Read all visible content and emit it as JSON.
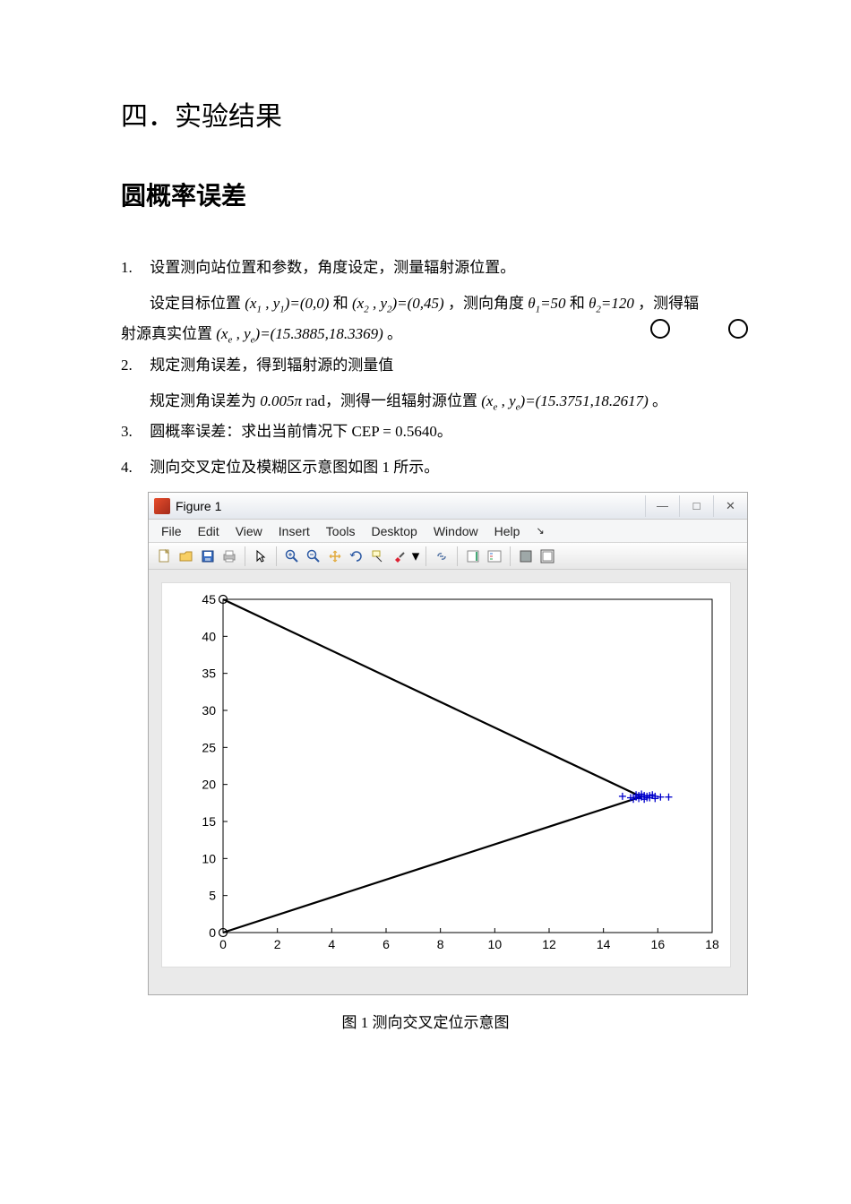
{
  "section_title": "四．实验结果",
  "subtitle": "圆概率误差",
  "items": {
    "i1_num": "1.",
    "i1_line1": "设置测向站位置和参数，角度设定，测量辐射源位置。",
    "i1_line2a": "设定目标位置",
    "i1_f1": "(x₁ , y₁)=(0,0)",
    "i1_txt_and": "和",
    "i1_f2": "(x₂ , y₂)=(0,45)",
    "i1_txt_angle": "，测向角度",
    "i1_f3": "θ₁=50",
    "i1_txt_and2": " 和",
    "i1_f4": "θ₂=120",
    "i1_txt_tail": "，测得辐",
    "i1_line3a": "射源真实位置",
    "i1_f5": "(xₑ , yₑ)=(15.3885,18.3369)",
    "i1_period": "。",
    "i2_num": "2.",
    "i2_line1": " 规定测角误差，得到辐射源的测量值",
    "i2_line2a": "规定测角误差为",
    "i2_f1": "0.005π",
    "i2_txt_rad": "  rad，测得一组辐射源位置",
    "i2_f2": "(xₑ , yₑ)=(15.3751,18.2617)",
    "i2_period": "。",
    "i3_num": "3.",
    "i3_text": "圆概率误差：求出当前情况下 CEP = 0.5640。",
    "i4_num": "4.",
    "i4_text": "测向交叉定位及模糊区示意图如图 1 所示。"
  },
  "figure": {
    "title": "Figure 1",
    "menu": {
      "file": "File",
      "edit": "Edit",
      "view": "View",
      "insert": "Insert",
      "tools": "Tools",
      "desktop": "Desktop",
      "window": "Window",
      "help": "Help"
    },
    "caption": "图 1 测向交叉定位示意图",
    "winmin": "—",
    "winmax": "□",
    "winclose": "✕"
  },
  "chart_data": {
    "type": "line",
    "xlabel": "",
    "ylabel": "",
    "xlim": [
      0,
      18
    ],
    "ylim": [
      0,
      45
    ],
    "xticks": [
      0,
      2,
      4,
      6,
      8,
      10,
      12,
      14,
      16,
      18
    ],
    "yticks": [
      0,
      5,
      10,
      15,
      20,
      25,
      30,
      35,
      40,
      45
    ],
    "series": [
      {
        "name": "ray-from-station1",
        "x": [
          0,
          15.3885
        ],
        "y": [
          0,
          18.3369
        ]
      },
      {
        "name": "ray-from-station2",
        "x": [
          0,
          15.3885
        ],
        "y": [
          45,
          18.3369
        ]
      }
    ],
    "stations": [
      {
        "name": "station-1",
        "x": 0,
        "y": 0
      },
      {
        "name": "station-2",
        "x": 0,
        "y": 45
      }
    ],
    "scatter_estimates": {
      "center": [
        15.38,
        18.3
      ],
      "approx_points": [
        [
          14.7,
          18.4
        ],
        [
          15.0,
          18.2
        ],
        [
          15.2,
          18.6
        ],
        [
          15.3,
          18.1
        ],
        [
          15.4,
          18.3
        ],
        [
          15.5,
          18.5
        ],
        [
          15.5,
          18.0
        ],
        [
          15.6,
          18.4
        ],
        [
          15.7,
          18.2
        ],
        [
          15.8,
          18.6
        ],
        [
          15.9,
          18.1
        ],
        [
          16.1,
          18.3
        ],
        [
          16.4,
          18.3
        ],
        [
          15.1,
          18.0
        ],
        [
          15.4,
          18.7
        ],
        [
          15.2,
          18.3
        ],
        [
          15.6,
          18.2
        ],
        [
          15.7,
          18.5
        ],
        [
          15.3,
          18.5
        ],
        [
          15.9,
          18.4
        ]
      ]
    }
  }
}
